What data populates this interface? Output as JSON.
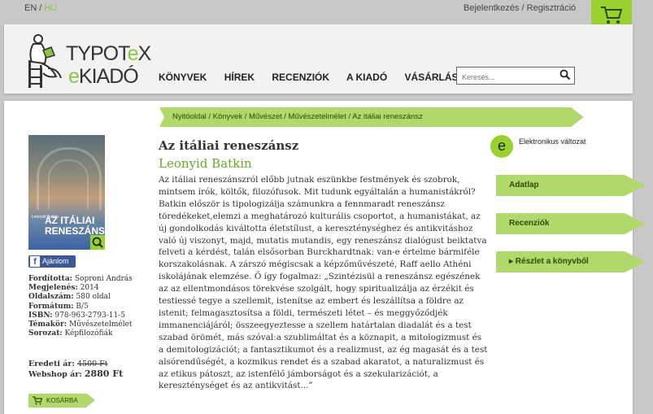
{
  "topbar": {
    "lang_en": "EN",
    "lang_sep": "/",
    "lang_hu": "HU",
    "login": "Bejelentkezés / Regisztráció"
  },
  "logo": {
    "line1_a": "TYPOT",
    "line1_b": "e",
    "line1_c": "X",
    "line2_a": "e",
    "line2_b": "KIADÓ"
  },
  "nav": {
    "items": [
      "KÖNYVEK",
      "HÍREK",
      "RECENZIÓK",
      "A KIADÓ",
      "VÁSÁRLÁS"
    ]
  },
  "search": {
    "placeholder": "Keresés..."
  },
  "breadcrumb": "Nyitóoldal / Könyvek / Művészet / Művészetelmélet / Az itáliai reneszánsz",
  "cover": {
    "author": "Leonyid Batkin",
    "title_line1": "AZ ITÁLIAI",
    "title_line2": "RENESZÁNSZ"
  },
  "facebook": {
    "label": "Ajánlom"
  },
  "meta": [
    {
      "label": "Fordította:",
      "value": "Soproni András"
    },
    {
      "label": "Megjelenés:",
      "value": "2014"
    },
    {
      "label": "Oldalszám:",
      "value": "580 oldal"
    },
    {
      "label": "Formátum:",
      "value": "B/5"
    },
    {
      "label": "ISBN:",
      "value": "978-963-2793-11-5"
    },
    {
      "label": "Témakör:",
      "value": "Művészetelmélet"
    },
    {
      "label": "Sorozat:",
      "value": "Képfilozófiák"
    }
  ],
  "price": {
    "original_label": "Eredeti ár:",
    "original_value": "4500 Ft",
    "webshop_label": "Webshop ár:",
    "webshop_value": "2880 Ft"
  },
  "cart_button": "KOSÁRBA",
  "book": {
    "title": "Az itáliai reneszánsz",
    "author": "Leonyid Batkin",
    "description": "Az itáliai reneszánszról előbb jutnak eszünkbe festmények és szobrok, mintsem írók, költők, filozófusok. Mit tudunk egyáltalán a humanistákról? Batkin először is tipologizálja számunkra a fennmaradt reneszánsz töredékeket,elemzi a meghatározó kulturális csoportot, a humanistákat, az új gondolkodás kiváltotta életstílust, a kereszténységhez és antikvitáshoz való új viszonyt, majd, mutatis mutandis, egy reneszánsz dialógust beiktatva felveti a kérdést, talán elsősorban Burckhardtnak: van-e értelme bármiféle korszakolásnak. A zárszó mégiscsak a képzőművészeté, Raff aello Athéni iskolájának elemzése. Ő így fogalmaz: „Szintézisül a reneszánsz egészének az az ellentmondásos törekvése szolgált, hogy spiritualizálja az érzékit és testiessé tegye a szellemit, istenítse az embert és leszállítsa a földre az istenit; felmagasztosítsa a földi, természeti létet – és meggyőződjék immanenciájáról; összeegyeztesse a szellem határtalan diadalát és a test szabad örömét, más szóval:a szublimáltat és a köznapit, a mitologizmust és a demitologizációt; a fantasztikumot és a realizmust, az ég magasát és a test alsórendűségét, a kozmikus rendet és a szabad akaratot, a naturalizmust és az etikus pátoszt, az istenfélő jámborságot és a szekularizációt, a kereszténységet és az antikvitást...”"
  },
  "ebook_label": "Elektronikus változat",
  "ebook_letter": "e",
  "side_tabs": [
    "Adatlap",
    "Recenziók",
    "▸ Részlet a könyvből"
  ]
}
